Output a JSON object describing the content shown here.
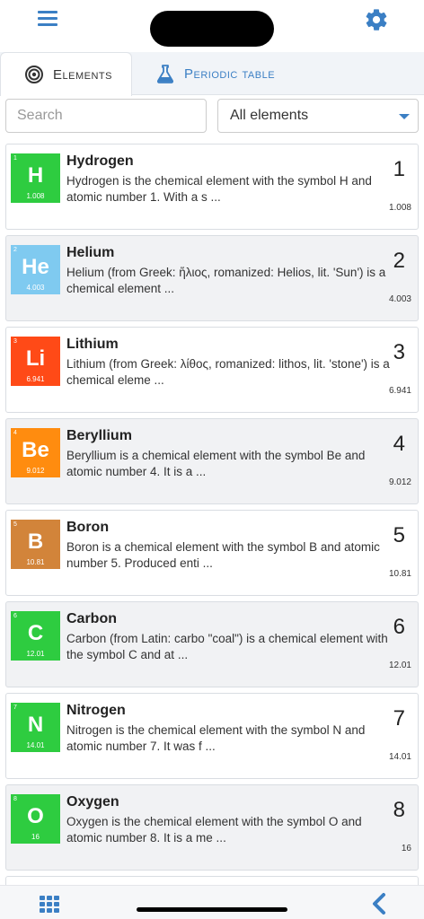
{
  "tabs": [
    {
      "label": "Elements",
      "icon": "target-icon"
    },
    {
      "label": "Periodic table",
      "icon": "flask-icon"
    }
  ],
  "search": {
    "placeholder": "Search"
  },
  "filter": {
    "selected": "All elements"
  },
  "colors": {
    "accent": "#3b7fc4"
  },
  "elements": [
    {
      "number": "1",
      "symbol": "H",
      "name": "Hydrogen",
      "mass": "1.008",
      "color": "#2ecc40",
      "description": "Hydrogen is the chemical element with the symbol H and atomic number 1. With a s ..."
    },
    {
      "number": "2",
      "symbol": "He",
      "name": "Helium",
      "mass": "4.003",
      "color": "#7fcaf0",
      "description": "Helium (from Greek: ἥλιος, romanized: Helios, lit. 'Sun') is a chemical element ..."
    },
    {
      "number": "3",
      "symbol": "Li",
      "name": "Lithium",
      "mass": "6.941",
      "color": "#ff4a17",
      "description": "Lithium (from Greek: λίθος, romanized: lithos, lit. 'stone') is a chemical eleme ..."
    },
    {
      "number": "4",
      "symbol": "Be",
      "name": "Beryllium",
      "mass": "9.012",
      "color": "#ff8c0f",
      "description": "Beryllium is a chemical element with the symbol Be and atomic number 4. It is a ..."
    },
    {
      "number": "5",
      "symbol": "B",
      "name": "Boron",
      "mass": "10.81",
      "color": "#d2843a",
      "description": "Boron is a chemical element with the symbol B and atomic number 5. Produced enti ..."
    },
    {
      "number": "6",
      "symbol": "C",
      "name": "Carbon",
      "mass": "12.01",
      "color": "#2ecc40",
      "description": "Carbon (from Latin: carbo \"coal\") is a chemical element with the symbol C and at ..."
    },
    {
      "number": "7",
      "symbol": "N",
      "name": "Nitrogen",
      "mass": "14.01",
      "color": "#2ecc40",
      "description": "Nitrogen is the chemical element with the symbol N and atomic number 7. It was f ..."
    },
    {
      "number": "8",
      "symbol": "O",
      "name": "Oxygen",
      "mass": "16",
      "color": "#2ecc40",
      "description": "Oxygen is the chemical element with the symbol O and atomic number 8. It is a me ..."
    },
    {
      "number": "",
      "symbol": "",
      "name": "",
      "mass": "",
      "color": "#f2d24a",
      "description": ""
    }
  ]
}
